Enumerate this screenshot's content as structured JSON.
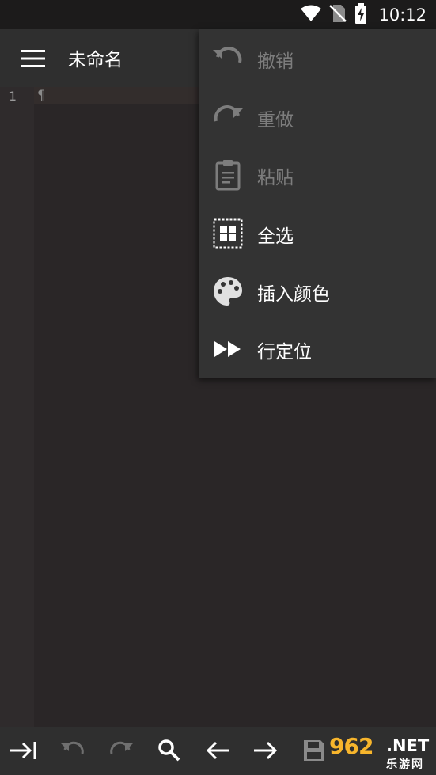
{
  "status_bar": {
    "time": "10:12"
  },
  "app_bar": {
    "title": "未命名"
  },
  "editor": {
    "line_numbers": [
      "1"
    ],
    "pilcrow": "¶"
  },
  "context_menu": {
    "items": [
      {
        "label": "撤销",
        "icon": "undo-icon",
        "enabled": false
      },
      {
        "label": "重做",
        "icon": "redo-icon",
        "enabled": false
      },
      {
        "label": "粘贴",
        "icon": "paste-icon",
        "enabled": false
      },
      {
        "label": "全选",
        "icon": "select-all-icon",
        "enabled": true
      },
      {
        "label": "插入颜色",
        "icon": "palette-icon",
        "enabled": true
      },
      {
        "label": "行定位",
        "icon": "go-to-line-icon",
        "enabled": true
      }
    ]
  },
  "bottom_toolbar": {
    "buttons": [
      "tab-indent-icon",
      "undo-icon",
      "redo-icon",
      "search-icon",
      "arrow-left-icon",
      "arrow-right-icon",
      "save-icon"
    ]
  },
  "watermark": {
    "number": "962",
    "domain": ".NET",
    "subtitle": "乐游网"
  },
  "colors": {
    "background": "#2a2627",
    "menu_bg": "#333333",
    "disabled_text": "#7d7d7d",
    "watermark_orange": "#f7b52c"
  }
}
